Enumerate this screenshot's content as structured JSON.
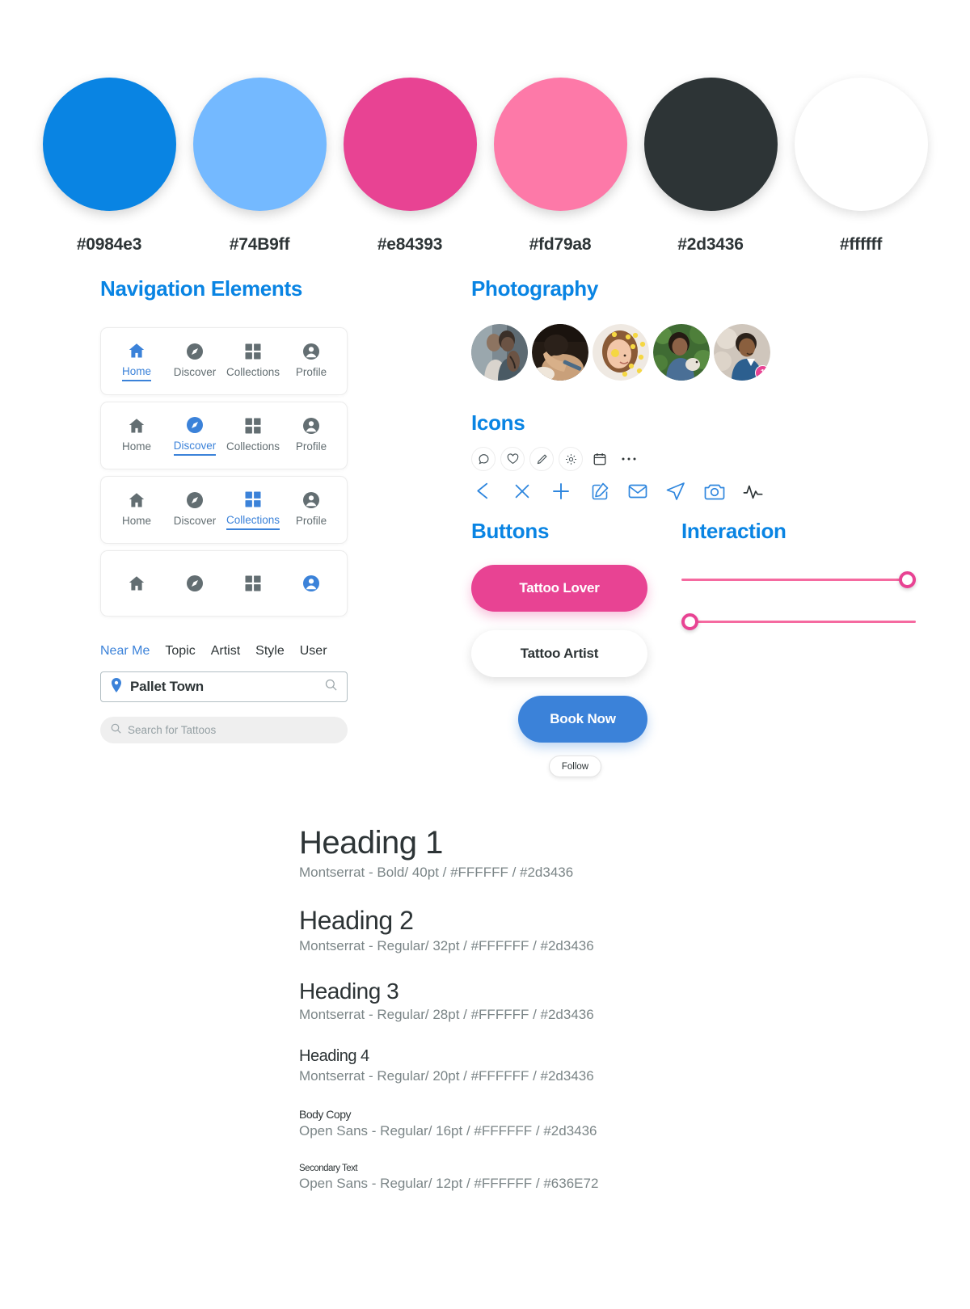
{
  "palette": {
    "swatches": [
      {
        "hex": "#0984e3",
        "label": "#0984e3"
      },
      {
        "hex": "#74B9ff",
        "label": "#74B9ff"
      },
      {
        "hex": "#e84393",
        "label": "#e84393"
      },
      {
        "hex": "#fd79a8",
        "label": "#fd79a8"
      },
      {
        "hex": "#2d3436",
        "label": "#2d3436"
      },
      {
        "hex": "#ffffff",
        "label": "#ffffff"
      }
    ]
  },
  "navigation": {
    "title": "Navigation Elements",
    "labels": {
      "home": "Home",
      "discover": "Discover",
      "collections": "Collections",
      "profile": "Profile"
    },
    "bars": [
      {
        "active": "home",
        "show_labels": true
      },
      {
        "active": "discover",
        "show_labels": true
      },
      {
        "active": "collections",
        "show_labels": true
      },
      {
        "active": "profile",
        "show_labels": false
      }
    ],
    "tabs": [
      {
        "label": "Near Me",
        "active": true
      },
      {
        "label": "Topic",
        "active": false
      },
      {
        "label": "Artist",
        "active": false
      },
      {
        "label": "Style",
        "active": false
      },
      {
        "label": "User",
        "active": false
      }
    ],
    "location_input": {
      "value": "Pallet Town",
      "icon": "map-pin-icon",
      "action_icon": "search-icon"
    },
    "search_input": {
      "placeholder": "Search for Tattoos",
      "icon": "search-icon"
    }
  },
  "photography": {
    "title": "Photography",
    "avatars": [
      {
        "name": "avatar-couple-tattoo"
      },
      {
        "name": "avatar-tattoo-artist-working"
      },
      {
        "name": "avatar-woman-yellow-flowers"
      },
      {
        "name": "avatar-woman-with-dog"
      },
      {
        "name": "avatar-man-portrait",
        "badge": "1"
      }
    ]
  },
  "icons": {
    "title": "Icons",
    "row1": [
      {
        "name": "chat-bubble-icon",
        "circled": true
      },
      {
        "name": "heart-icon",
        "circled": true
      },
      {
        "name": "pencil-icon",
        "circled": true
      },
      {
        "name": "gear-icon",
        "circled": true
      },
      {
        "name": "calendar-icon",
        "circled": false
      },
      {
        "name": "ellipsis-icon",
        "circled": false
      }
    ],
    "row2": [
      {
        "name": "arrow-left-icon"
      },
      {
        "name": "close-icon"
      },
      {
        "name": "plus-icon"
      },
      {
        "name": "edit-square-icon"
      },
      {
        "name": "mail-icon"
      },
      {
        "name": "send-icon"
      },
      {
        "name": "camera-icon"
      },
      {
        "name": "activity-icon"
      }
    ]
  },
  "buttons": {
    "title": "Buttons",
    "tattoo_lover": "Tattoo Lover",
    "tattoo_artist": "Tattoo Artist",
    "book_now": "Book Now",
    "follow": "Follow"
  },
  "interaction": {
    "title": "Interaction",
    "sliders": [
      {
        "name": "slider-knob-right",
        "position": "right"
      },
      {
        "name": "slider-knob-left",
        "position": "left"
      }
    ]
  },
  "typography": [
    {
      "sample": "Heading 1",
      "spec": "Montserrat -  Bold/ 40pt / #FFFFFF / #2d3436"
    },
    {
      "sample": "Heading 2",
      "spec": "Montserrat -  Regular/ 32pt / #FFFFFF / #2d3436"
    },
    {
      "sample": "Heading 3",
      "spec": "Montserrat -  Regular/ 28pt / #FFFFFF / #2d3436"
    },
    {
      "sample": "Heading 4",
      "spec": "Montserrat - Regular/ 20pt / #FFFFFF / #2d3436"
    },
    {
      "sample": "Body Copy",
      "spec": "Open Sans -  Regular/ 16pt / #FFFFFF / #2d3436"
    },
    {
      "sample": "Secondary Text",
      "spec": "Open Sans -  Regular/ 12pt / #FFFFFF / #636E72"
    }
  ]
}
